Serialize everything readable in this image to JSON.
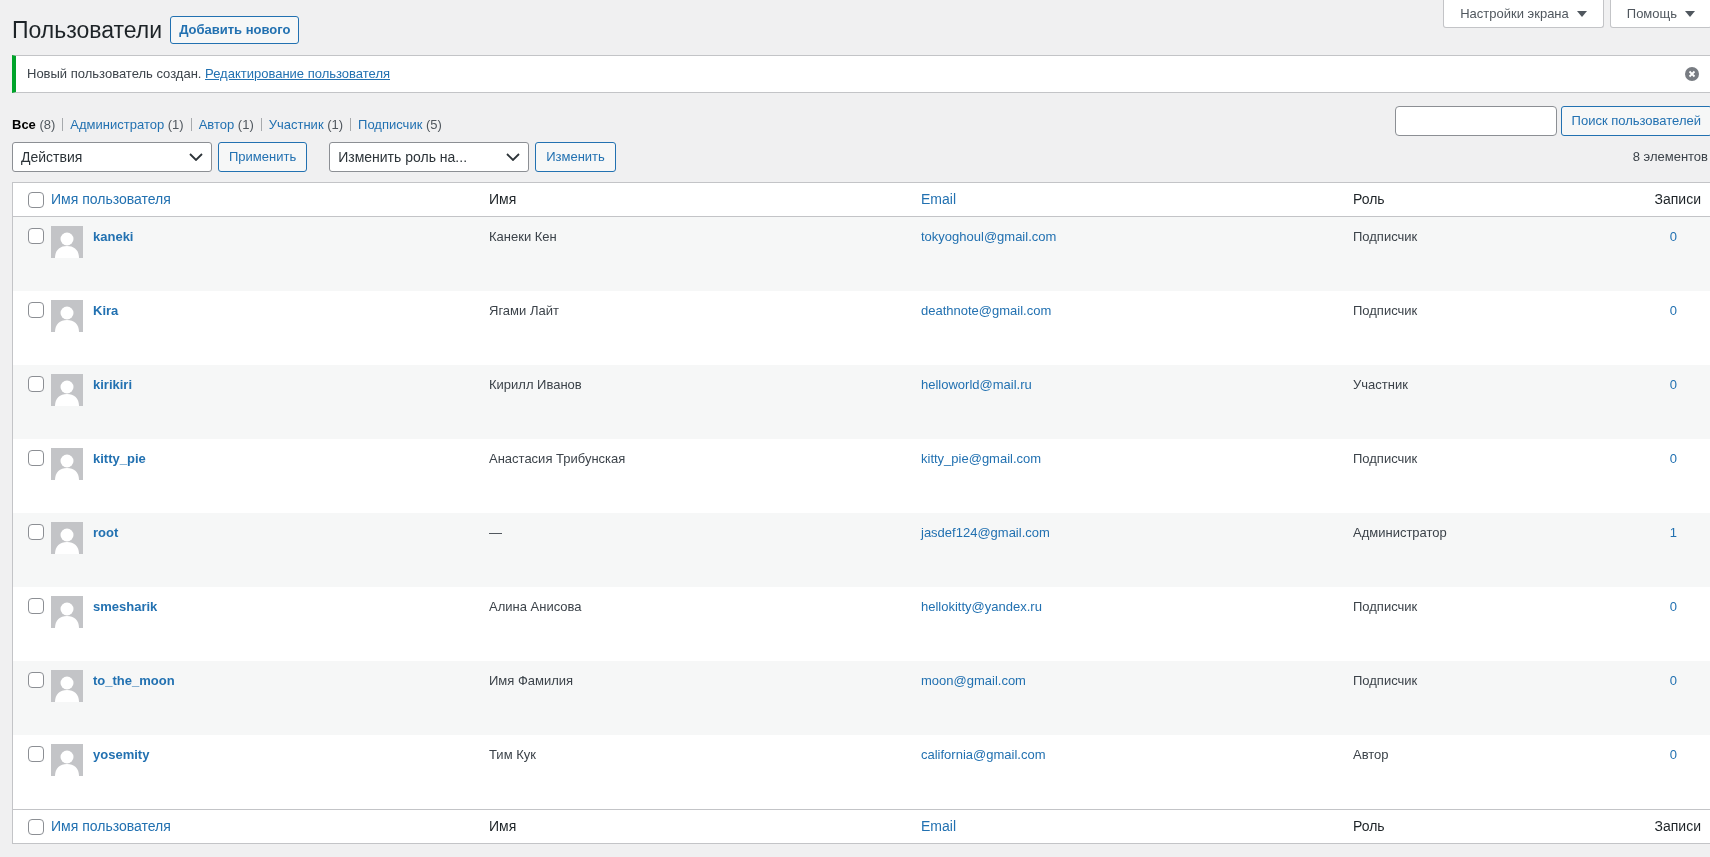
{
  "top_tabs": [
    {
      "label": "Настройки экрана"
    },
    {
      "label": "Помощь"
    }
  ],
  "page_title": "Пользователи",
  "add_button": "Добавить нового",
  "notice": {
    "text": "Новый пользователь создан.",
    "link": "Редактирование пользователя"
  },
  "filters": [
    {
      "label": "Все",
      "count": "(8)",
      "selected": true
    },
    {
      "label": "Администратор",
      "count": "(1)",
      "selected": false
    },
    {
      "label": "Автор",
      "count": "(1)",
      "selected": false
    },
    {
      "label": "Участник",
      "count": "(1)",
      "selected": false
    },
    {
      "label": "Подписчик",
      "count": "(5)",
      "selected": false
    }
  ],
  "search": {
    "button": "Поиск пользователей"
  },
  "bulk_actions": {
    "select": "Действия",
    "apply": "Применить"
  },
  "role_change": {
    "select": "Изменить роль на...",
    "apply": "Изменить"
  },
  "items_count": "8 элементов",
  "table": {
    "columns": [
      {
        "label": "Имя пользователя",
        "sortable": true
      },
      {
        "label": "Имя",
        "sortable": false
      },
      {
        "label": "Email",
        "sortable": true
      },
      {
        "label": "Роль",
        "sortable": false
      },
      {
        "label": "Записи",
        "sortable": false
      }
    ],
    "header_checked": false,
    "rows": [
      {
        "username": "kaneki",
        "name": "Канеки Кен",
        "email": "tokyoghoul@gmail.com",
        "role": "Подписчик",
        "posts": "0",
        "checked": false
      },
      {
        "username": "Kira",
        "name": "Ягами Лайт",
        "email": "deathnote@gmail.com",
        "role": "Подписчик",
        "posts": "0",
        "checked": false
      },
      {
        "username": "kirikiri",
        "name": "Кирилл Иванов",
        "email": "helloworld@mail.ru",
        "role": "Участник",
        "posts": "0",
        "checked": false
      },
      {
        "username": "kitty_pie",
        "name": "Анастасия Трибунская",
        "email": "kitty_pie@gmail.com",
        "role": "Подписчик",
        "posts": "0",
        "checked": false
      },
      {
        "username": "root",
        "name": "—",
        "email": "jasdef124@gmail.com",
        "role": "Администратор",
        "posts": "1",
        "checked": false
      },
      {
        "username": "smesharik",
        "name": "Алина Анисова",
        "email": "hellokitty@yandex.ru",
        "role": "Подписчик",
        "posts": "0",
        "checked": false
      },
      {
        "username": "to_the_moon",
        "name": "Имя Фамилия",
        "email": "moon@gmail.com",
        "role": "Подписчик",
        "posts": "0",
        "checked": false
      },
      {
        "username": "yosemity",
        "name": "Тим Кук",
        "email": "california@gmail.com",
        "role": "Автор",
        "posts": "0",
        "checked": false
      }
    ],
    "footer_columns": [
      {
        "label": "Имя пользователя",
        "sortable": true
      },
      {
        "label": "Имя",
        "sortable": false
      },
      {
        "label": "Email",
        "sortable": true
      },
      {
        "label": "Роль",
        "sortable": false
      },
      {
        "label": "Записи",
        "sortable": false
      }
    ],
    "footer_checked": false
  }
}
